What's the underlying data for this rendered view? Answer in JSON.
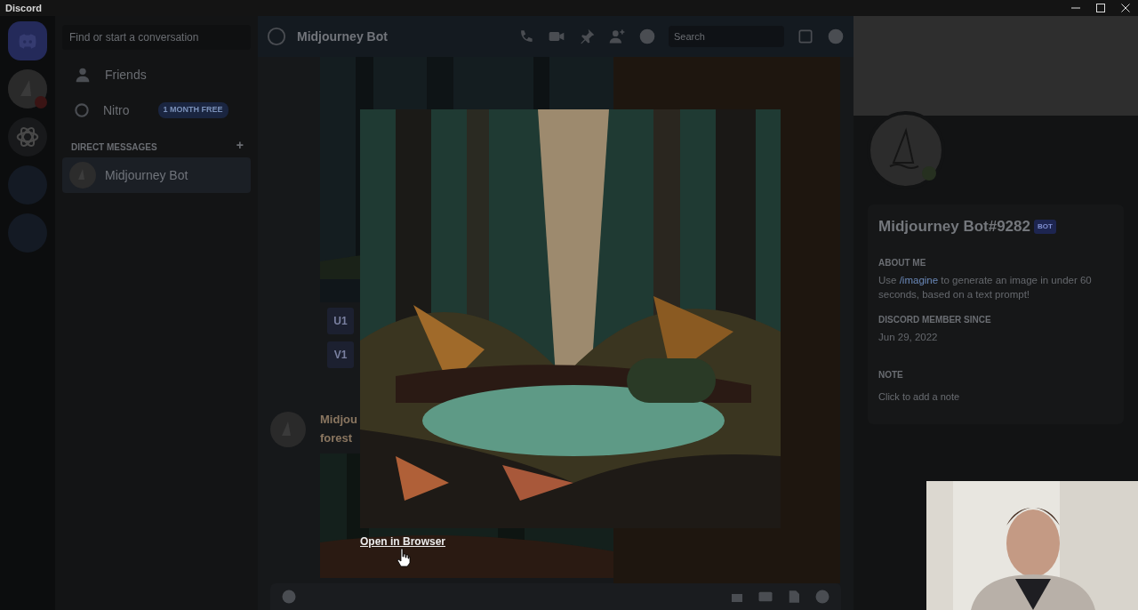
{
  "window": {
    "title": "Discord"
  },
  "servers": [
    {
      "kind": "home",
      "selected": true
    },
    {
      "kind": "avatar",
      "selected": false
    },
    {
      "kind": "openai",
      "selected": false
    },
    {
      "kind": "blank",
      "selected": false
    },
    {
      "kind": "blank",
      "selected": false
    }
  ],
  "dm_sidebar": {
    "search": {
      "placeholder": "Find or start a conversation"
    },
    "nav": [
      {
        "kind": "friends",
        "label": "Friends"
      },
      {
        "kind": "nitro",
        "label": "Nitro",
        "badge": "1 MONTH FREE"
      }
    ],
    "section": "DIRECT MESSAGES",
    "add": "+",
    "dms": [
      {
        "name": "Midjourney Bot",
        "selected": true
      }
    ]
  },
  "chat": {
    "title": "Midjourney Bot",
    "search": {
      "placeholder": "Search"
    },
    "buttons": [
      "U1",
      "V1"
    ],
    "message": {
      "author": "Midjou",
      "text": "forest"
    }
  },
  "profile": {
    "name": "Midjourney Bot#9282",
    "tag": "BOT",
    "about_title": "ABOUT ME",
    "about": {
      "before": "Use",
      "command": "/imagine",
      "after": "to generate an image in under 60 seconds, based on a text prompt!"
    },
    "since_title": "DISCORD MEMBER SINCE",
    "since": "Jun 29, 2022",
    "note_title": "NOTE",
    "note_placeholder": "Click to add a note"
  },
  "viewer": {
    "link": "Open in Browser"
  }
}
